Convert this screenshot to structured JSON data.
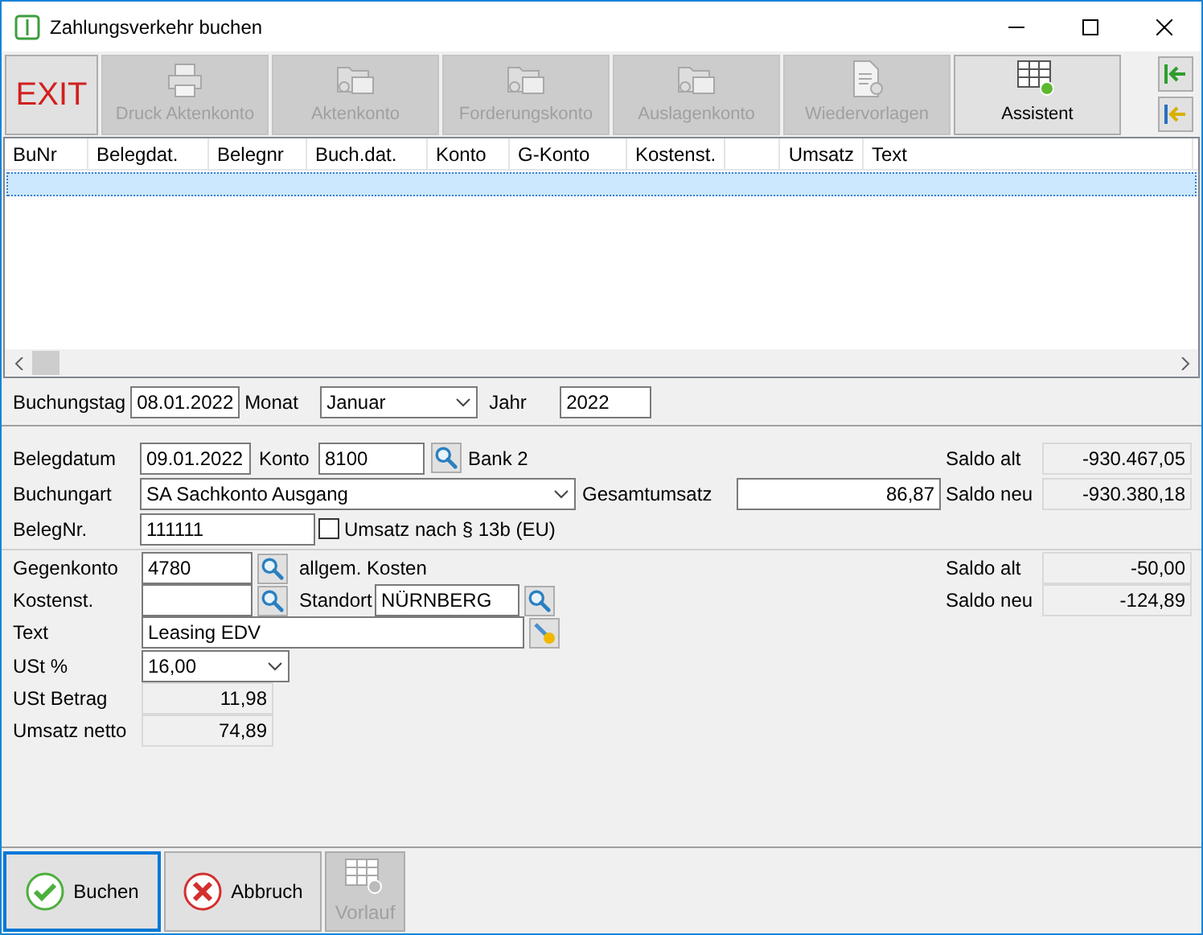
{
  "window": {
    "title": "Zahlungsverkehr buchen"
  },
  "toolbar": [
    {
      "kind": "exit",
      "label": "EXIT",
      "disabled": false
    },
    {
      "kind": "printer",
      "label": "Druck Aktenkonto",
      "disabled": true
    },
    {
      "kind": "folder",
      "label": "Aktenkonto",
      "disabled": true
    },
    {
      "kind": "folder",
      "label": "Forderungskonto",
      "disabled": true
    },
    {
      "kind": "folder",
      "label": "Auslagenkonto",
      "disabled": true
    },
    {
      "kind": "document",
      "label": "Wiedervorlagen",
      "disabled": true
    },
    {
      "kind": "grid",
      "label": "Assistent",
      "disabled": false
    }
  ],
  "table": {
    "columns": [
      "BuNr",
      "Belegdat.",
      "Belegnr",
      "Buch.dat.",
      "Konto",
      "G-Konto",
      "Kostenst.",
      "",
      "Umsatz",
      "Text"
    ],
    "rows": [
      {
        "selected": true
      }
    ]
  },
  "header": {
    "buchungstag_label": "Buchungstag",
    "buchungstag": "08.01.2022",
    "monat_label": "Monat",
    "monat": "Januar",
    "jahr_label": "Jahr",
    "jahr": "2022"
  },
  "beleg": {
    "belegdatum_label": "Belegdatum",
    "belegdatum": "09.01.2022",
    "konto_label": "Konto",
    "konto": "8100",
    "konto_name": "Bank 2",
    "buchungart_label": "Buchungart",
    "buchungart": "SA Sachkonto Ausgang",
    "gesamtumsatz_label": "Gesamtumsatz",
    "gesamtumsatz": "86,87",
    "belegnr_label": "BelegNr.",
    "belegnr": "111111",
    "umsatz_13b": {
      "label": "Umsatz nach § 13b (EU)",
      "checked": false
    },
    "saldo_alt_label": "Saldo alt",
    "saldo_alt": "-930.467,05",
    "saldo_neu_label": "Saldo neu",
    "saldo_neu": "-930.380,18"
  },
  "gegen": {
    "gegenkonto_label": "Gegenkonto",
    "gegenkonto": "4780",
    "gegenkonto_name": "allgem. Kosten",
    "kostenst_label": "Kostenst.",
    "standort_label": "Standort",
    "standort": "NÜRNBERG",
    "text_label": "Text",
    "text": "Leasing EDV",
    "ust_label": "USt %",
    "ust": "16,00",
    "ust_betrag_label": "USt Betrag",
    "ust_betrag": "11,98",
    "netto_label": "Umsatz netto",
    "netto": "74,89",
    "saldo_alt_label": "Saldo alt",
    "saldo_alt": "-50,00",
    "saldo_neu_label": "Saldo neu",
    "saldo_neu": "-124,89"
  },
  "buttons": [
    {
      "kind": "ok",
      "label": "Buchen",
      "disabled": false,
      "focused": true
    },
    {
      "kind": "cancel",
      "label": "Abbruch",
      "disabled": false,
      "focused": false
    },
    {
      "kind": "grid",
      "label": "Vorlauf",
      "disabled": true,
      "focused": false
    }
  ]
}
